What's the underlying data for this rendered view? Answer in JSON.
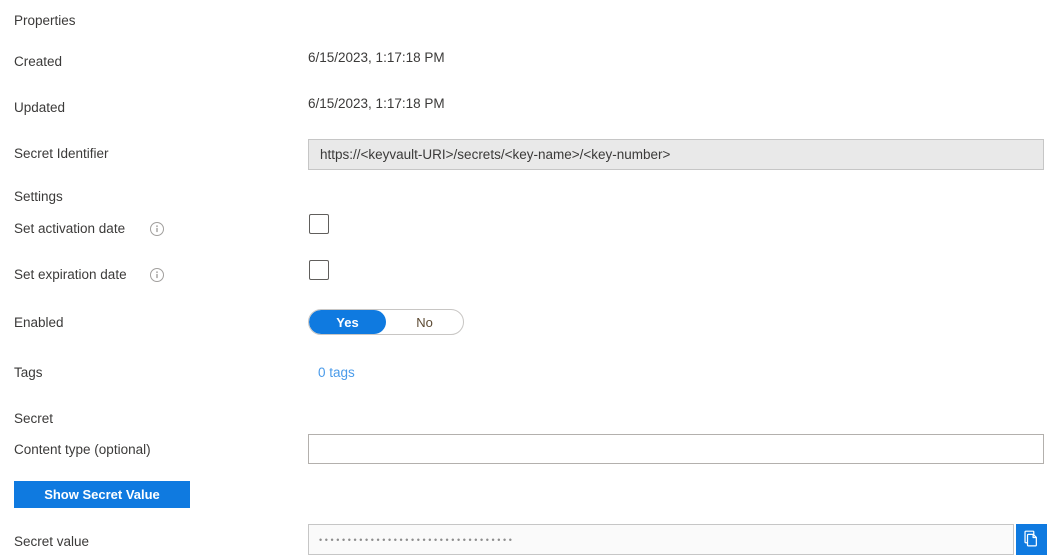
{
  "sections": {
    "properties_header": "Properties",
    "settings_header": "Settings",
    "secret_header": "Secret"
  },
  "fields": {
    "created": {
      "label": "Created",
      "value": "6/15/2023, 1:17:18 PM"
    },
    "updated": {
      "label": "Updated",
      "value": "6/15/2023, 1:17:18 PM"
    },
    "secret_identifier": {
      "label": "Secret Identifier",
      "value": "https://<keyvault-URI>/secrets/<key-name>/<key-number>"
    },
    "set_activation_date": {
      "label": "Set activation date",
      "checked": false,
      "info_icon": "info-icon"
    },
    "set_expiration_date": {
      "label": "Set expiration date",
      "checked": false,
      "info_icon": "info-icon"
    },
    "enabled": {
      "label": "Enabled",
      "option_yes": "Yes",
      "option_no": "No",
      "selected": "Yes"
    },
    "tags": {
      "label": "Tags",
      "link_text": "0 tags"
    },
    "content_type": {
      "label": "Content type (optional)",
      "value": "",
      "placeholder": ""
    },
    "secret_value": {
      "label": "Secret value",
      "masked_value": "••••••••••••••••••••••••••••••••••",
      "copy_icon": "copy-icon"
    }
  },
  "buttons": {
    "show_secret_value": "Show Secret Value"
  },
  "colors": {
    "accent": "#0f7ae0",
    "link": "#4a9bea",
    "text": "#3b3a39",
    "readonly_bg": "#e9e9e9"
  }
}
